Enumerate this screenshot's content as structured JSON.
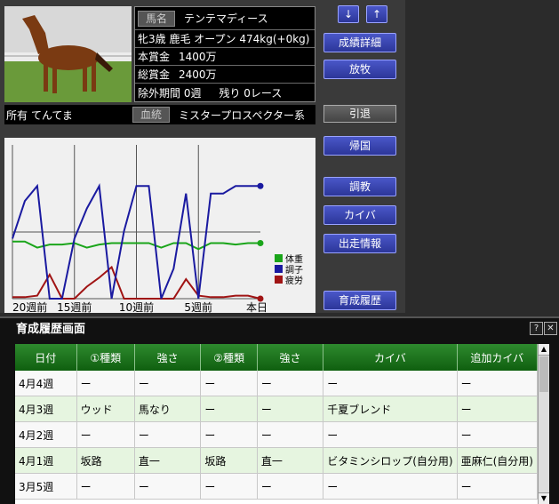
{
  "horse": {
    "name_label": "馬名",
    "name": "テンテマディース",
    "details": "牝3歳 鹿毛 オープン 474kg(+0kg)",
    "prize_label": "本賞金",
    "prize": "1400万",
    "total_label": "総賞金",
    "total": "2400万",
    "exclusion": "除外期間 0週",
    "remaining": "残り 0レース",
    "owner_label": "所有",
    "owner": "てんてま",
    "blood_label": "血統",
    "bloodline": "ミスタープロスペクター系"
  },
  "buttons": {
    "down": "↓",
    "up": "↑",
    "results": "成績詳細",
    "release": "放牧",
    "retire": "引退",
    "return": "帰国",
    "training": "調教",
    "feed": "カイバ",
    "race_info": "出走情報",
    "history": "育成履歴"
  },
  "chart_data": {
    "type": "line",
    "x_ticks": [
      "20週前",
      "15週前",
      "10週前",
      "5週前",
      "本日"
    ],
    "legend": [
      "体重",
      "調子",
      "疲労"
    ],
    "colors": {
      "体重": "#1aa51a",
      "調子": "#1a1aa0",
      "疲労": "#a01414"
    },
    "x": [
      20,
      19,
      18,
      17,
      16,
      15,
      14,
      13,
      12,
      11,
      10,
      9,
      8,
      7,
      6,
      5,
      4,
      3,
      2,
      1,
      0
    ],
    "series": [
      {
        "name": "調子",
        "values": [
          40,
          65,
          75,
          0,
          0,
          40,
          60,
          75,
          0,
          45,
          75,
          75,
          0,
          20,
          70,
          0,
          70,
          70,
          75,
          75,
          75
        ]
      },
      {
        "name": "体重",
        "values": [
          38,
          38,
          34,
          36,
          36,
          37,
          34,
          36,
          37,
          37,
          37,
          37,
          34,
          37,
          37,
          33,
          37,
          37,
          36,
          37,
          37
        ]
      },
      {
        "name": "疲労",
        "values": [
          1,
          1,
          2,
          16,
          0,
          0,
          8,
          14,
          21,
          0,
          0,
          0,
          0,
          0,
          13,
          2,
          1,
          1,
          2,
          2,
          0
        ]
      }
    ],
    "ylim": [
      0,
      100
    ]
  },
  "history": {
    "title": "育成履歴画面",
    "help": "?",
    "close": "✕",
    "columns": [
      "日付",
      "①種類",
      "強さ",
      "②種類",
      "強さ",
      "カイバ",
      "追加カイバ"
    ],
    "rows": [
      [
        "4月4週",
        "ー",
        "ー",
        "ー",
        "ー",
        "ー",
        "ー"
      ],
      [
        "4月3週",
        "ウッド",
        "馬なり",
        "ー",
        "ー",
        "千夏ブレンド",
        "ー"
      ],
      [
        "4月2週",
        "ー",
        "ー",
        "ー",
        "ー",
        "ー",
        "ー"
      ],
      [
        "4月1週",
        "坂路",
        "直一",
        "坂路",
        "直一",
        "ビタミンシロップ(自分用)",
        "亜麻仁(自分用)"
      ],
      [
        "3月5週",
        "ー",
        "ー",
        "ー",
        "ー",
        "ー",
        "ー"
      ]
    ]
  }
}
